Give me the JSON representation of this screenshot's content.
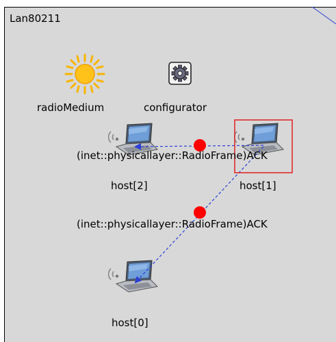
{
  "network": {
    "name": "Lan80211"
  },
  "modules": {
    "radio_medium": {
      "label": "radioMedium",
      "icon": "sun-icon"
    },
    "configurator": {
      "label": "configurator",
      "icon": "gear-icon"
    },
    "host2": {
      "label": "host[2]",
      "icon": "laptop-wireless-icon"
    },
    "host1": {
      "label": "host[1]",
      "icon": "laptop-wireless-icon",
      "selected": true
    },
    "host0": {
      "label": "host[0]",
      "icon": "laptop-wireless-icon"
    }
  },
  "messages": [
    {
      "label": "(inet::physicallayer::RadioFrame)ACK",
      "from": "host[1]",
      "to": "host[2]"
    },
    {
      "label": "(inet::physicallayer::RadioFrame)ACK",
      "from": "host[1]",
      "to": "host[0]"
    }
  ],
  "colors": {
    "canvas_bg": "#d8d8d8",
    "selection": "#e02020",
    "message_dot": "#ff0000",
    "message_line": "#2b3fd6"
  }
}
